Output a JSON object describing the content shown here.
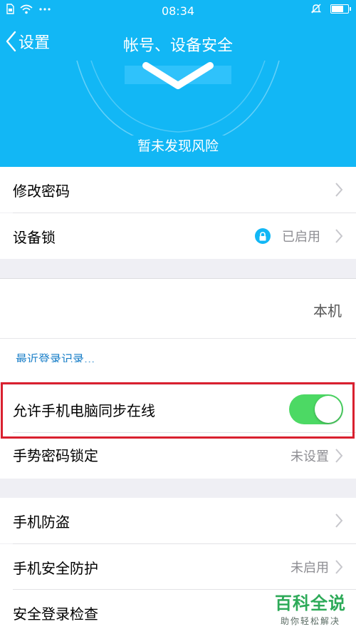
{
  "status_bar": {
    "time": "08:34"
  },
  "nav": {
    "back_label": "设置",
    "title": "帐号、设备安全"
  },
  "risk_status": "暂未发现风险",
  "rows": {
    "change_password": {
      "label": "修改密码"
    },
    "device_lock": {
      "label": "设备锁",
      "value": "已启用"
    },
    "this_device": {
      "value": "本机"
    },
    "recent_login": {
      "label": "最近登录记录..."
    },
    "sync_online": {
      "label": "允许手机电脑同步在线",
      "enabled": true
    },
    "gesture_lock": {
      "label": "手势密码锁定",
      "value": "未设置"
    },
    "anti_theft": {
      "label": "手机防盗"
    },
    "security_protection": {
      "label": "手机安全防护",
      "value": "未启用"
    },
    "login_check": {
      "label": "安全登录检查"
    }
  },
  "watermark": {
    "title": "百科全说",
    "subtitle": "助你轻松解决"
  },
  "colors": {
    "header": "#12b7f5",
    "toggle_on": "#4cd964",
    "highlight": "#d9202f",
    "link": "#1a7fc8"
  }
}
